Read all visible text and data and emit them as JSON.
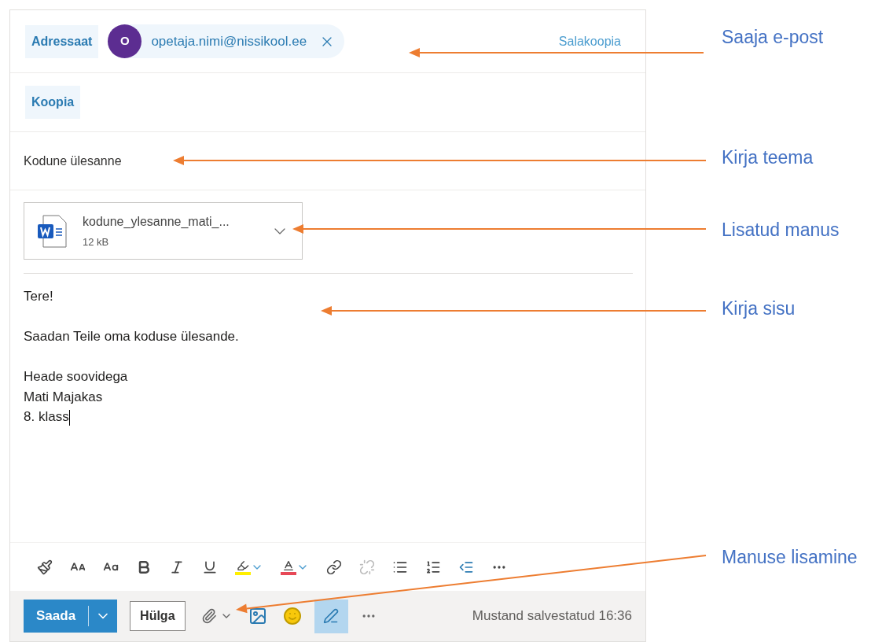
{
  "to": {
    "label": "Adressaat",
    "recipient": {
      "initial": "O",
      "email": "opetaja.nimi@nissikool.ee"
    },
    "bcc_link": "Salakoopia"
  },
  "cc": {
    "label": "Koopia"
  },
  "subject": "Kodune ülesanne",
  "attachment": {
    "name": "kodune_ylesanne_mati_...",
    "size": "12 kB"
  },
  "body": [
    [
      "Tere!"
    ],
    [
      "Saadan Teile oma koduse ülesande."
    ],
    [
      "Heade soovidega",
      "Mati Majakas",
      "8. klass"
    ]
  ],
  "footer": {
    "send": "Saada",
    "discard": "Hülga",
    "signature_selected": true,
    "status": "Mustand salvestatud 16:36"
  },
  "annotations": [
    {
      "label": "Saaja e-post"
    },
    {
      "label": "Kirja teema"
    },
    {
      "label": "Lisatud manus"
    },
    {
      "label": "Kirja sisu"
    },
    {
      "label": "Manuse lisamine"
    }
  ]
}
